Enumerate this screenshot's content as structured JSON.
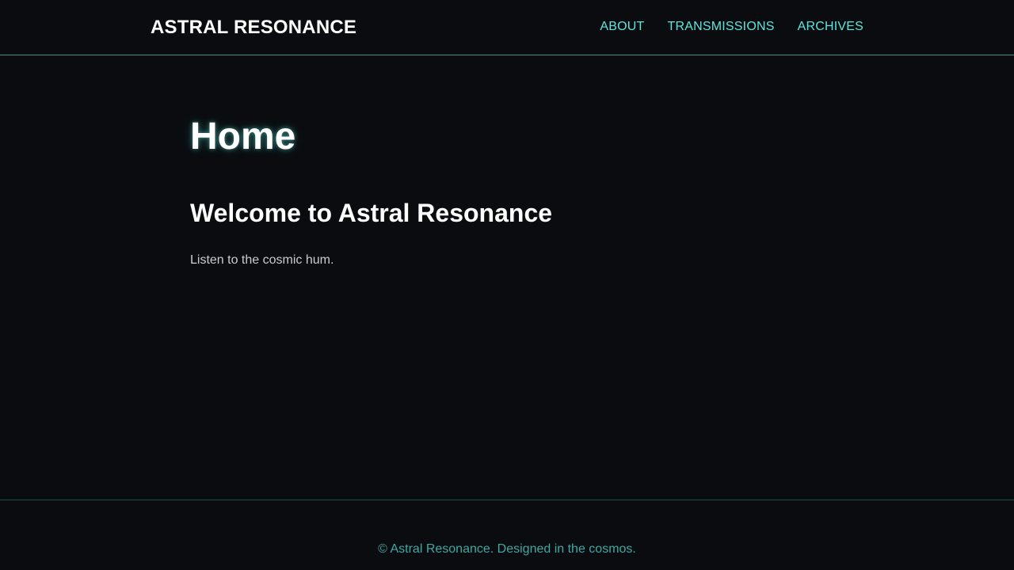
{
  "header": {
    "brand": "ASTRAL RESONANCE",
    "nav": [
      {
        "label": "ABOUT"
      },
      {
        "label": "TRANSMISSIONS"
      },
      {
        "label": "ARCHIVES"
      }
    ]
  },
  "main": {
    "title": "Home",
    "heading": "Welcome to Astral Resonance",
    "text": "Listen to the cosmic hum."
  },
  "footer": {
    "text": "© Astral Resonance. Designed in the cosmos."
  },
  "colors": {
    "background": "#0a0c10",
    "accent": "#5ee6dc",
    "footer_text": "#3fa9a2",
    "divider": "#3a8f8a"
  }
}
